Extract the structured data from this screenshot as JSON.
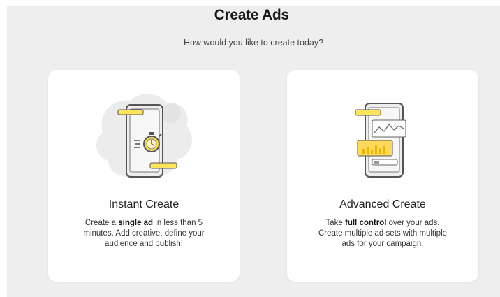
{
  "header": {
    "title": "Create Ads",
    "subtitle": "How would you like to create today?"
  },
  "cards": [
    {
      "title": "Instant Create",
      "desc_pre": "Create a ",
      "desc_bold": "single ad",
      "desc_post": " in less than 5 minutes. Add creative, define your audience and publish!",
      "icon": "phone-stopwatch-icon"
    },
    {
      "title": "Advanced Create",
      "desc_pre": "Take ",
      "desc_bold": "full control",
      "desc_post": " over your ads. Create multiple ad sets with multiple ads for your campaign.",
      "icon": "phone-charts-icon"
    }
  ],
  "colors": {
    "accent_yellow": "#fffc00",
    "card_bg": "#ffffff",
    "page_bg": "#eeeeee"
  }
}
